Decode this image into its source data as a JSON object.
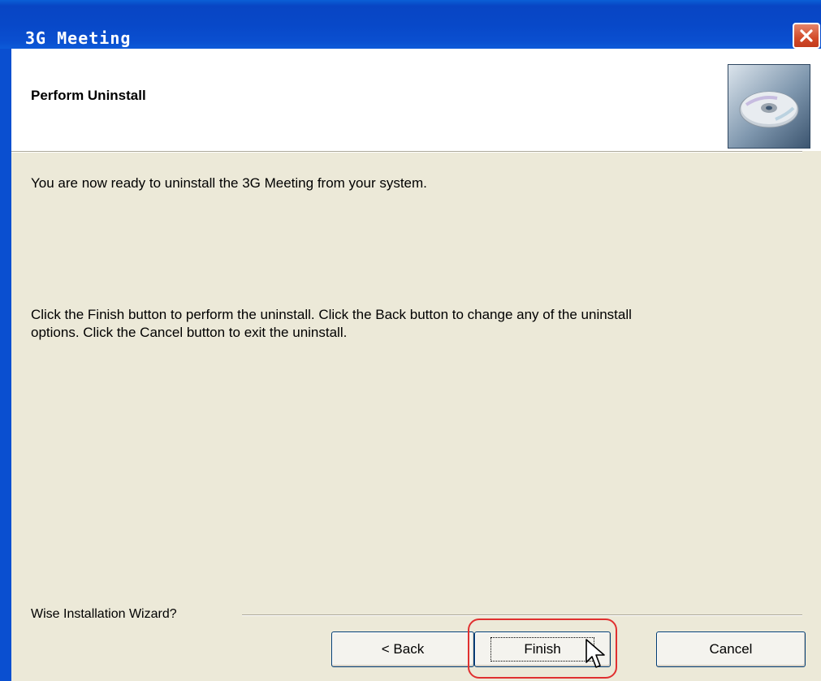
{
  "window": {
    "title": "3G Meeting"
  },
  "header": {
    "title": "Perform Uninstall"
  },
  "body": {
    "ready_message": "You are now ready to uninstall the 3G Meeting from your system.",
    "instructions_line1": "Click the Finish button to perform the uninstall. Click the Back button to change any of the uninstall",
    "instructions_line2": "options. Click the Cancel button to exit the uninstall."
  },
  "footer": {
    "wizard_label": "Wise Installation Wizard?",
    "back_label": "< Back",
    "finish_label": "Finish",
    "cancel_label": "Cancel"
  },
  "colors": {
    "titlebar": "#0848c8",
    "dialog_bg": "#ece9d8",
    "highlight_circle": "#e03030",
    "close_button": "#d34b2a"
  },
  "icons": [
    "close-icon",
    "cd-disc-icon",
    "mouse-cursor-icon"
  ]
}
